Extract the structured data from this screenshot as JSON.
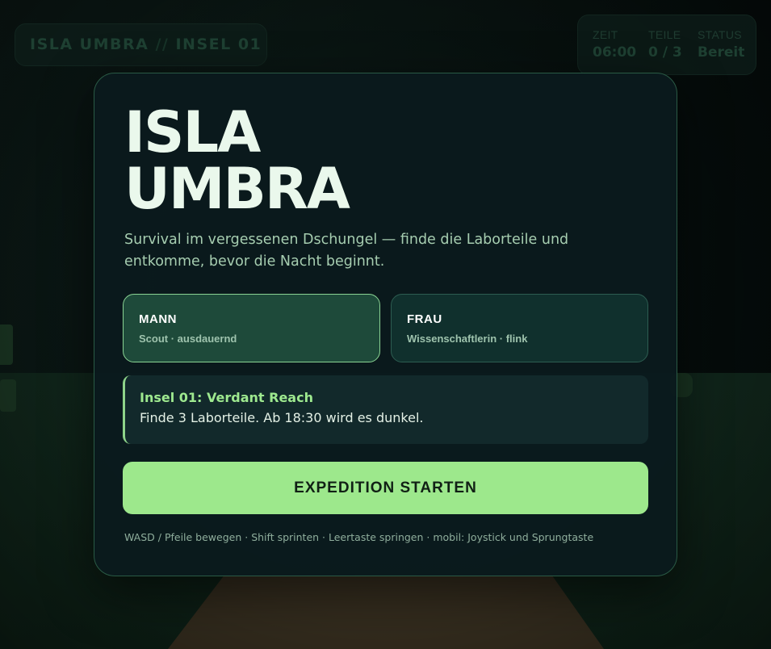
{
  "hud": {
    "title_main": "ISLA UMBRA",
    "title_sep": "//",
    "title_island": "INSEL 01",
    "stats": {
      "time_label": "ZEIT",
      "time_value": "06:00",
      "parts_label": "TEILE",
      "parts_value": "0 / 3",
      "status_label": "STATUS",
      "status_value": "Bereit"
    }
  },
  "menu": {
    "title_line1": "ISLA",
    "title_line2": "UMBRA",
    "subtitle": "Survival im vergessenen Dschungel — finde die Laborteile und entkomme, bevor die Nacht beginnt.",
    "characters": [
      {
        "name": "MANN",
        "description": "Scout · ausdauernd",
        "selected": true
      },
      {
        "name": "FRAU",
        "description": "Wissenschaftlerin · flink",
        "selected": false
      }
    ],
    "mission": {
      "title": "Insel 01: Verdant Reach",
      "text": "Finde 3 Laborteile. Ab 18:30 wird es dunkel."
    },
    "start_label": "EXPEDITION STARTEN",
    "controls_hint": "WASD / Pfeile bewegen · Shift sprinten · Leertaste springen · mobil: Joystick und Sprungtaste"
  },
  "colors": {
    "accent": "#9de88c",
    "card_bg": "#0a1a1d",
    "selected_border": "#8ad494"
  }
}
